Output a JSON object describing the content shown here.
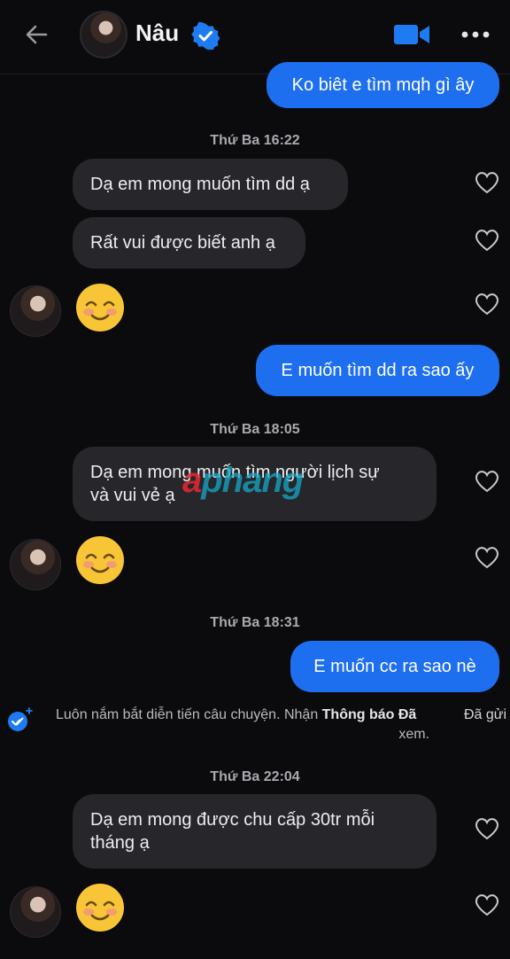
{
  "header": {
    "contact_name": "Nâu",
    "back_icon": "arrow-left-icon",
    "verified_icon": "verified-badge-icon",
    "video_icon": "video-camera-icon",
    "more_icon": "more-dots-icon"
  },
  "colors": {
    "background": "#0b0b0d",
    "incoming_bubble": "#26262b",
    "outgoing_bubble": "#1e6ff0",
    "accent": "#1e6ff0"
  },
  "messages": {
    "m1": "Ko biêt e tìm mqh gì ây",
    "t1": "Thứ Ba 16:22",
    "m2": "Dạ em mong muốn tìm dd ạ",
    "m3": "Rất vui được biết anh ạ",
    "m4_emoji": "☺️",
    "m5": "E muốn tìm dd ra sao ấy",
    "t2": "Thứ Ba 18:05",
    "m6_line1": "Dạ em mong muốn tìm người lịch sự",
    "m6_line2": "và vui vẻ ạ",
    "m7_emoji": "☺️",
    "t3": "Thứ Ba 18:31",
    "m8": "E muốn cc ra sao nè",
    "t4": "Thứ Ba 22:04",
    "m9_line1": "Dạ em mong được chu cấp 30tr mỗi",
    "m9_line2": "tháng ạ",
    "m10_emoji": "☺️"
  },
  "notice": {
    "text": "Luôn nắm bắt diễn tiến câu chuyện. Nhận ",
    "bold": "Thông báo Đã",
    "bold_suffix": "xem.",
    "status": "Đã gửi"
  },
  "watermark": {
    "letter": "a",
    "rest": "phang"
  }
}
